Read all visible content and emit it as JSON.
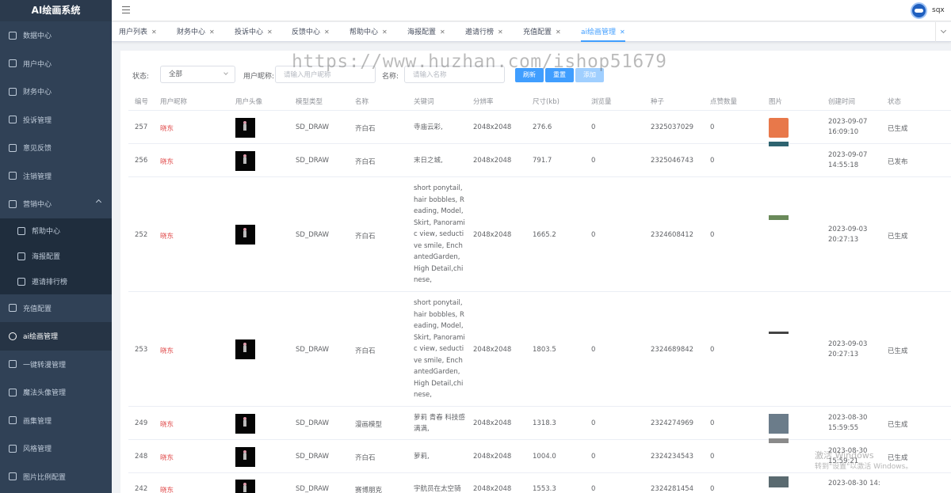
{
  "app": {
    "title": "AI绘画系统"
  },
  "header": {
    "username": "sqx"
  },
  "sidebar": {
    "items": [
      {
        "label": "数据中心"
      },
      {
        "label": "用户中心"
      },
      {
        "label": "财务中心"
      },
      {
        "label": "投诉管理"
      },
      {
        "label": "意见反馈"
      },
      {
        "label": "注销管理"
      },
      {
        "label": "营销中心"
      },
      {
        "label": "充值配置"
      },
      {
        "label": "ai绘画管理"
      },
      {
        "label": "一键转漫管理"
      },
      {
        "label": "魔法头像管理"
      },
      {
        "label": "画集管理"
      },
      {
        "label": "风格管理"
      },
      {
        "label": "图片比例配置"
      }
    ],
    "submenu": [
      {
        "label": "帮助中心"
      },
      {
        "label": "海报配置"
      },
      {
        "label": "邀请排行榜"
      }
    ]
  },
  "tags": [
    {
      "label": "用户列表"
    },
    {
      "label": "财务中心"
    },
    {
      "label": "投诉中心"
    },
    {
      "label": "反馈中心"
    },
    {
      "label": "帮助中心"
    },
    {
      "label": "海报配置"
    },
    {
      "label": "邀请行榜"
    },
    {
      "label": "充值配置"
    },
    {
      "label": "ai绘画管理"
    }
  ],
  "watermark": "https://www.huzhan.com/ishop51679",
  "filters": {
    "status_label": "状态:",
    "status_value": "全部",
    "nick_label": "用户昵称:",
    "nick_placeholder": "请输入用户昵称",
    "name_label": "名称:",
    "name_placeholder": "请输入名称",
    "refresh": "刷新",
    "reset": "重置",
    "add": "添加"
  },
  "table": {
    "headers": [
      "编号",
      "用户昵称",
      "用户头像",
      "模型类型",
      "名称",
      "关键词",
      "分辨率",
      "尺寸(kb)",
      "浏览量",
      "种子",
      "点赞数量",
      "图片",
      "创建时间",
      "状态"
    ],
    "rows": [
      {
        "id": "257",
        "nick": "晓东",
        "model": "SD_DRAW",
        "name": "齐白石",
        "keywords": "寺庙云彩,",
        "res": "2048x2048",
        "size": "276.6",
        "views": "0",
        "seed": "2325037029",
        "likes": "0",
        "time": "2023-09-07 16:09:10",
        "status": "已生成"
      },
      {
        "id": "256",
        "nick": "晓东",
        "model": "SD_DRAW",
        "name": "齐白石",
        "keywords": "末日之城,",
        "res": "2048x2048",
        "size": "791.7",
        "views": "0",
        "seed": "2325046743",
        "likes": "0",
        "time": "2023-09-07 14:55:18",
        "status": "已发布"
      },
      {
        "id": "252",
        "nick": "晓东",
        "model": "SD_DRAW",
        "name": "齐白石",
        "keywords": "short ponytail, hair bobbles, Reading, Model, Skirt, Panoramic view, seductive smile, EnchantedGarden, High Detail,chinese,",
        "res": "2048x2048",
        "size": "1665.2",
        "views": "0",
        "seed": "2324608412",
        "likes": "0",
        "time": "2023-09-03 20:27:13",
        "status": "已生成"
      },
      {
        "id": "253",
        "nick": "晓东",
        "model": "SD_DRAW",
        "name": "齐白石",
        "keywords": "short ponytail, hair bobbles, Reading, Model, Skirt, Panoramic view, seductive smile, EnchantedGarden, High Detail,chinese,",
        "res": "2048x2048",
        "size": "1803.5",
        "views": "0",
        "seed": "2324689842",
        "likes": "0",
        "time": "2023-09-03 20:27:13",
        "status": "已生成"
      },
      {
        "id": "249",
        "nick": "晓东",
        "model": "SD_DRAW",
        "name": "漫画模型",
        "keywords": "萝莉 青春 科技感满满,",
        "res": "2048x2048",
        "size": "1318.3",
        "views": "0",
        "seed": "2324274969",
        "likes": "0",
        "time": "2023-08-30 15:59:55",
        "status": "已生成"
      },
      {
        "id": "248",
        "nick": "晓东",
        "model": "SD_DRAW",
        "name": "齐白石",
        "keywords": "萝莉,",
        "res": "2048x2048",
        "size": "1004.0",
        "views": "0",
        "seed": "2324234543",
        "likes": "0",
        "time": "2023-08-30 15:59:21",
        "status": "已生成"
      },
      {
        "id": "242",
        "nick": "晓东",
        "model": "SD_DRAW",
        "name": "赛博朋克",
        "keywords": "宇航员在太空骑",
        "res": "2048x2048",
        "size": "1553.3",
        "views": "0",
        "seed": "2324281454",
        "likes": "0",
        "time": "2023-08-30 14:",
        "status": ""
      }
    ]
  },
  "os_notice": {
    "line1": "激活 Windows",
    "line2": "转到\"设置\"以激活 Windows。"
  },
  "colors": {
    "sidebar_bg": "#304156",
    "accent": "#409eff",
    "nick": "#e04a4a"
  }
}
